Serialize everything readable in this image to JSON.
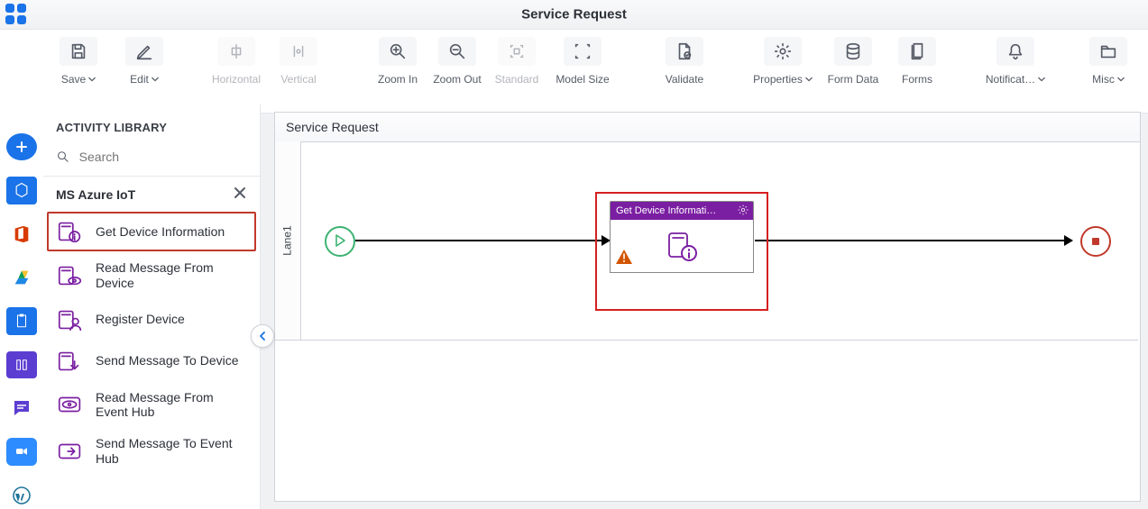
{
  "header": {
    "title": "Service Request"
  },
  "toolbar": {
    "save": "Save",
    "edit": "Edit",
    "horizontal": "Horizontal",
    "vertical": "Vertical",
    "zoom_in": "Zoom In",
    "zoom_out": "Zoom Out",
    "standard": "Standard",
    "model_size": "Model Size",
    "validate": "Validate",
    "properties": "Properties",
    "form_data": "Form Data",
    "forms": "Forms",
    "notifications": "Notificat…",
    "misc": "Misc"
  },
  "panel": {
    "title": "ACTIVITY LIBRARY",
    "search_placeholder": "Search",
    "section_title": "MS Azure IoT",
    "items": [
      {
        "label": "Get Device Information"
      },
      {
        "label": "Read Message From Device"
      },
      {
        "label": "Register Device"
      },
      {
        "label": "Send Message To Device"
      },
      {
        "label": "Read Message From Event Hub"
      },
      {
        "label": "Send Message To Event Hub"
      }
    ]
  },
  "diagram": {
    "title": "Service Request",
    "lane_name": "Lane1",
    "task_title": "Get Device Informati…"
  }
}
